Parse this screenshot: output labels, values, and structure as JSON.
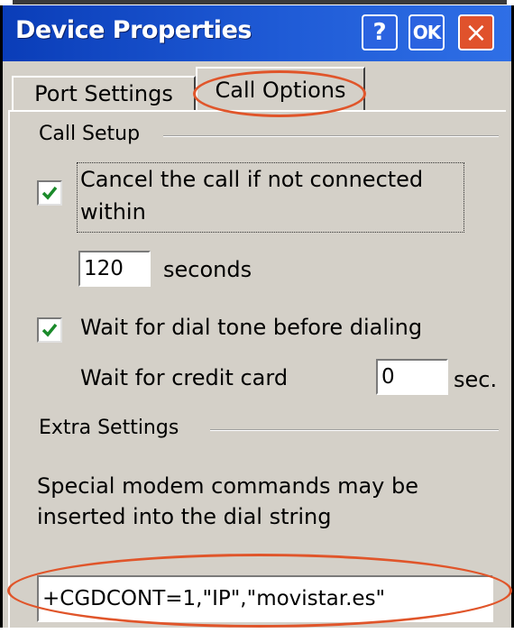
{
  "window": {
    "title": "Device Properties",
    "help_label": "?",
    "ok_label": "OK",
    "close_label": "×"
  },
  "tabs": [
    {
      "label": "Port Settings",
      "selected": false
    },
    {
      "label": "Call Options",
      "selected": true
    }
  ],
  "call_setup": {
    "heading": "Call Setup",
    "cancel_checkbox": {
      "label_line1": "Cancel the call if not connected",
      "label_line2": "within",
      "checked": true
    },
    "seconds_value": "120",
    "seconds_unit": "seconds",
    "dial_tone_checkbox": {
      "label": "Wait for dial tone before dialing",
      "checked": true
    },
    "credit_card_label": "Wait for credit card",
    "credit_card_value": "0",
    "credit_card_unit": "sec."
  },
  "extra_settings": {
    "heading": "Extra Settings",
    "description_line1": "Special modem commands may be",
    "description_line2": "inserted into the dial string",
    "command_value": "+CGDCONT=1,\"IP\",\"movistar.es\""
  },
  "colors": {
    "titlebar": "#1f5bd6",
    "highlight_oval": "#e0552a",
    "check": "#1a8a2a",
    "close_button": "#e0522c"
  }
}
